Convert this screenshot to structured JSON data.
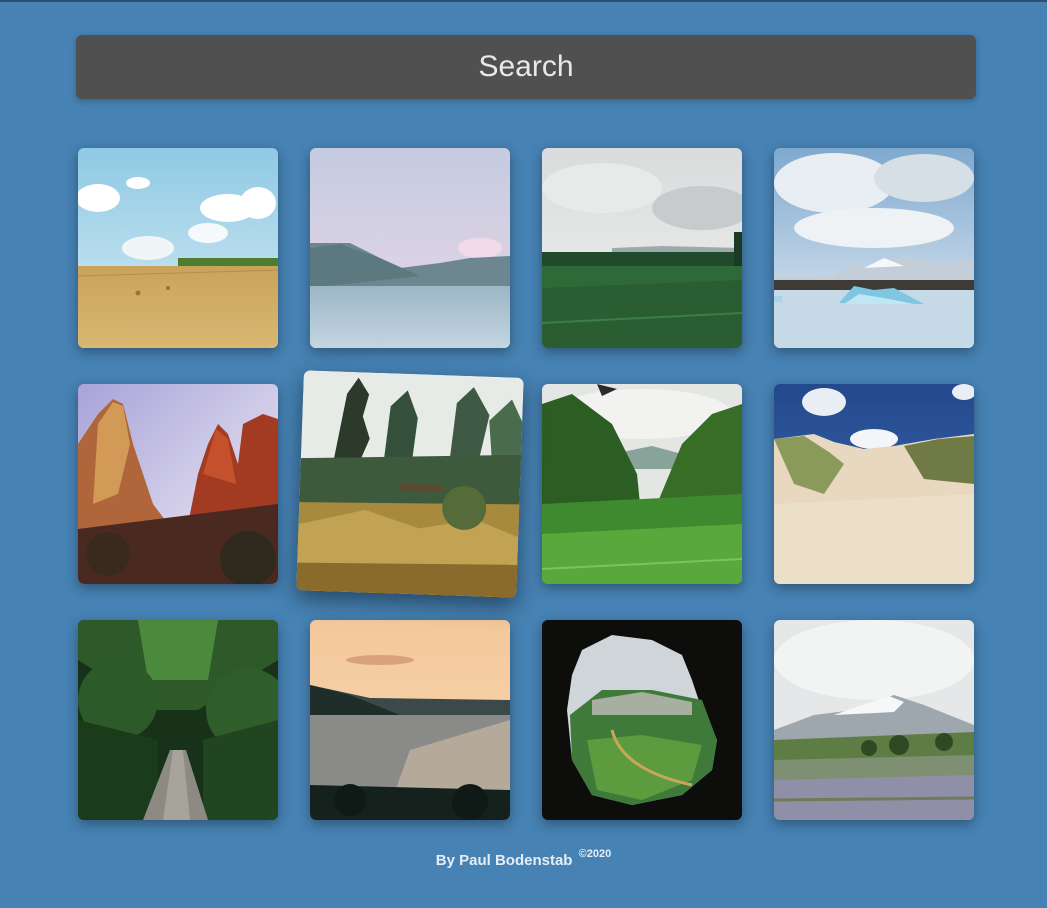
{
  "search": {
    "placeholder": "Search"
  },
  "gallery": {
    "tiles": [
      {
        "id": "tile-wheat-field",
        "icon": "photo-wheat-field"
      },
      {
        "id": "tile-lake-mountains",
        "icon": "photo-lake-mountains"
      },
      {
        "id": "tile-green-meadow",
        "icon": "photo-green-meadow"
      },
      {
        "id": "tile-glacier-lagoon",
        "icon": "photo-glacier-lagoon"
      },
      {
        "id": "tile-red-rock-canyon",
        "icon": "photo-red-rock-canyon"
      },
      {
        "id": "tile-forest-garden",
        "icon": "photo-forest-garden",
        "hovered": true
      },
      {
        "id": "tile-green-valley",
        "icon": "photo-green-valley"
      },
      {
        "id": "tile-sand-dunes",
        "icon": "photo-sand-dunes"
      },
      {
        "id": "tile-forest-path",
        "icon": "photo-forest-path"
      },
      {
        "id": "tile-sunset-coast",
        "icon": "photo-sunset-coast"
      },
      {
        "id": "tile-cave-view",
        "icon": "photo-cave-view"
      },
      {
        "id": "tile-mountain-meadow",
        "icon": "photo-mountain-meadow"
      }
    ]
  },
  "footer": {
    "author": "By Paul Bodenstab",
    "copyright": "©2020"
  },
  "colors": {
    "background": "#4682b4",
    "search_bar": "#505050",
    "search_text": "#e8e8e8",
    "footer_text": "#e6edf5"
  }
}
